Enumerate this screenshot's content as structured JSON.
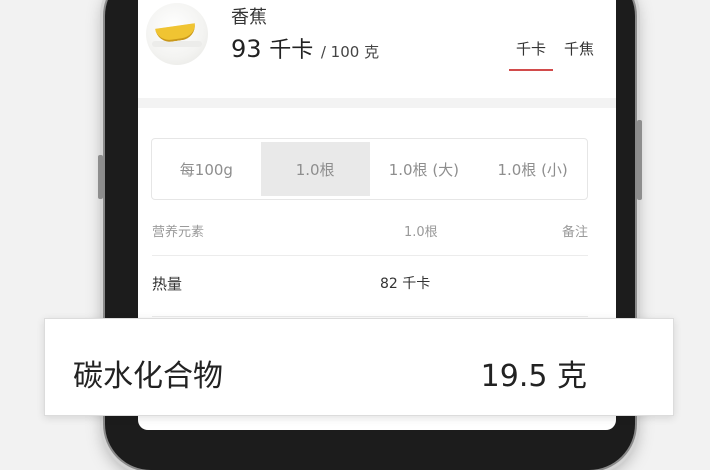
{
  "food": {
    "name": "香蕉",
    "energy_value": "93",
    "energy_unit": "千卡",
    "per_amount": "/ 100 克"
  },
  "unit_tabs": [
    {
      "label": "千卡",
      "active": true
    },
    {
      "label": "千焦",
      "active": false
    }
  ],
  "portion_options": [
    {
      "label": "每100g",
      "selected": false
    },
    {
      "label": "1.0根",
      "selected": true
    },
    {
      "label": "1.0根 (大)",
      "selected": false
    },
    {
      "label": "1.0根 (小)",
      "selected": false
    }
  ],
  "nutrition_table": {
    "headers": [
      "营养元素",
      "1.0根",
      "备注"
    ],
    "rows": [
      {
        "nutrient": "热量",
        "amount": "82 千卡",
        "note": ""
      }
    ]
  },
  "callout": {
    "label": "碳水化合物",
    "value": "19.5 克"
  },
  "colors": {
    "accent": "#d24b4b",
    "selected_segment": "#e9e9e9"
  }
}
